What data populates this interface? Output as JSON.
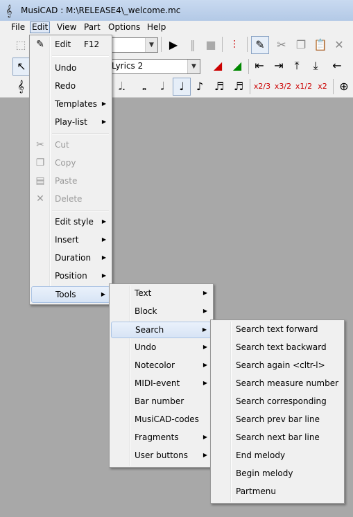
{
  "window": {
    "title": "MusiCAD : M:\\RELEASE4\\_welcome.mc"
  },
  "menubar": [
    {
      "label": "File"
    },
    {
      "label": "Edit"
    },
    {
      "label": "View"
    },
    {
      "label": "Part"
    },
    {
      "label": "Options"
    },
    {
      "label": "Help"
    }
  ],
  "toolbar2": {
    "lyrics_value": "Lyrics 2"
  },
  "toolbar3": {
    "note_labels": [
      "x2/3",
      "x3/2",
      "x1/2",
      "x2"
    ]
  },
  "edit_menu": [
    {
      "label": "Edit",
      "shortcut": "F12",
      "icon": "pencil-icon"
    },
    {
      "label": "Undo"
    },
    {
      "label": "Redo"
    },
    {
      "label": "Templates"
    },
    {
      "label": "Play-list"
    },
    {
      "label": "Cut",
      "icon": "scissors-icon"
    },
    {
      "label": "Copy",
      "icon": "copy-icon"
    },
    {
      "label": "Paste",
      "icon": "paste-icon"
    },
    {
      "label": "Delete",
      "icon": "delete-x-icon"
    },
    {
      "label": "Edit style"
    },
    {
      "label": "Insert"
    },
    {
      "label": "Duration"
    },
    {
      "label": "Position"
    },
    {
      "label": "Tools"
    }
  ],
  "tools_menu": [
    {
      "label": "Text"
    },
    {
      "label": "Block"
    },
    {
      "label": "Search"
    },
    {
      "label": "Undo"
    },
    {
      "label": "Notecolor"
    },
    {
      "label": "MIDI-event"
    },
    {
      "label": "Bar number"
    },
    {
      "label": "MusiCAD-codes"
    },
    {
      "label": "Fragments"
    },
    {
      "label": "User buttons"
    }
  ],
  "search_menu": [
    {
      "label": "Search text forward"
    },
    {
      "label": "Search text backward"
    },
    {
      "label": "Search again <cltr-l>"
    },
    {
      "label": "Search measure number"
    },
    {
      "label": "Search corresponding"
    },
    {
      "label": "Search prev bar line"
    },
    {
      "label": "Search next bar line"
    },
    {
      "label": "End melody"
    },
    {
      "label": "Begin melody"
    },
    {
      "label": "Partmenu"
    }
  ]
}
